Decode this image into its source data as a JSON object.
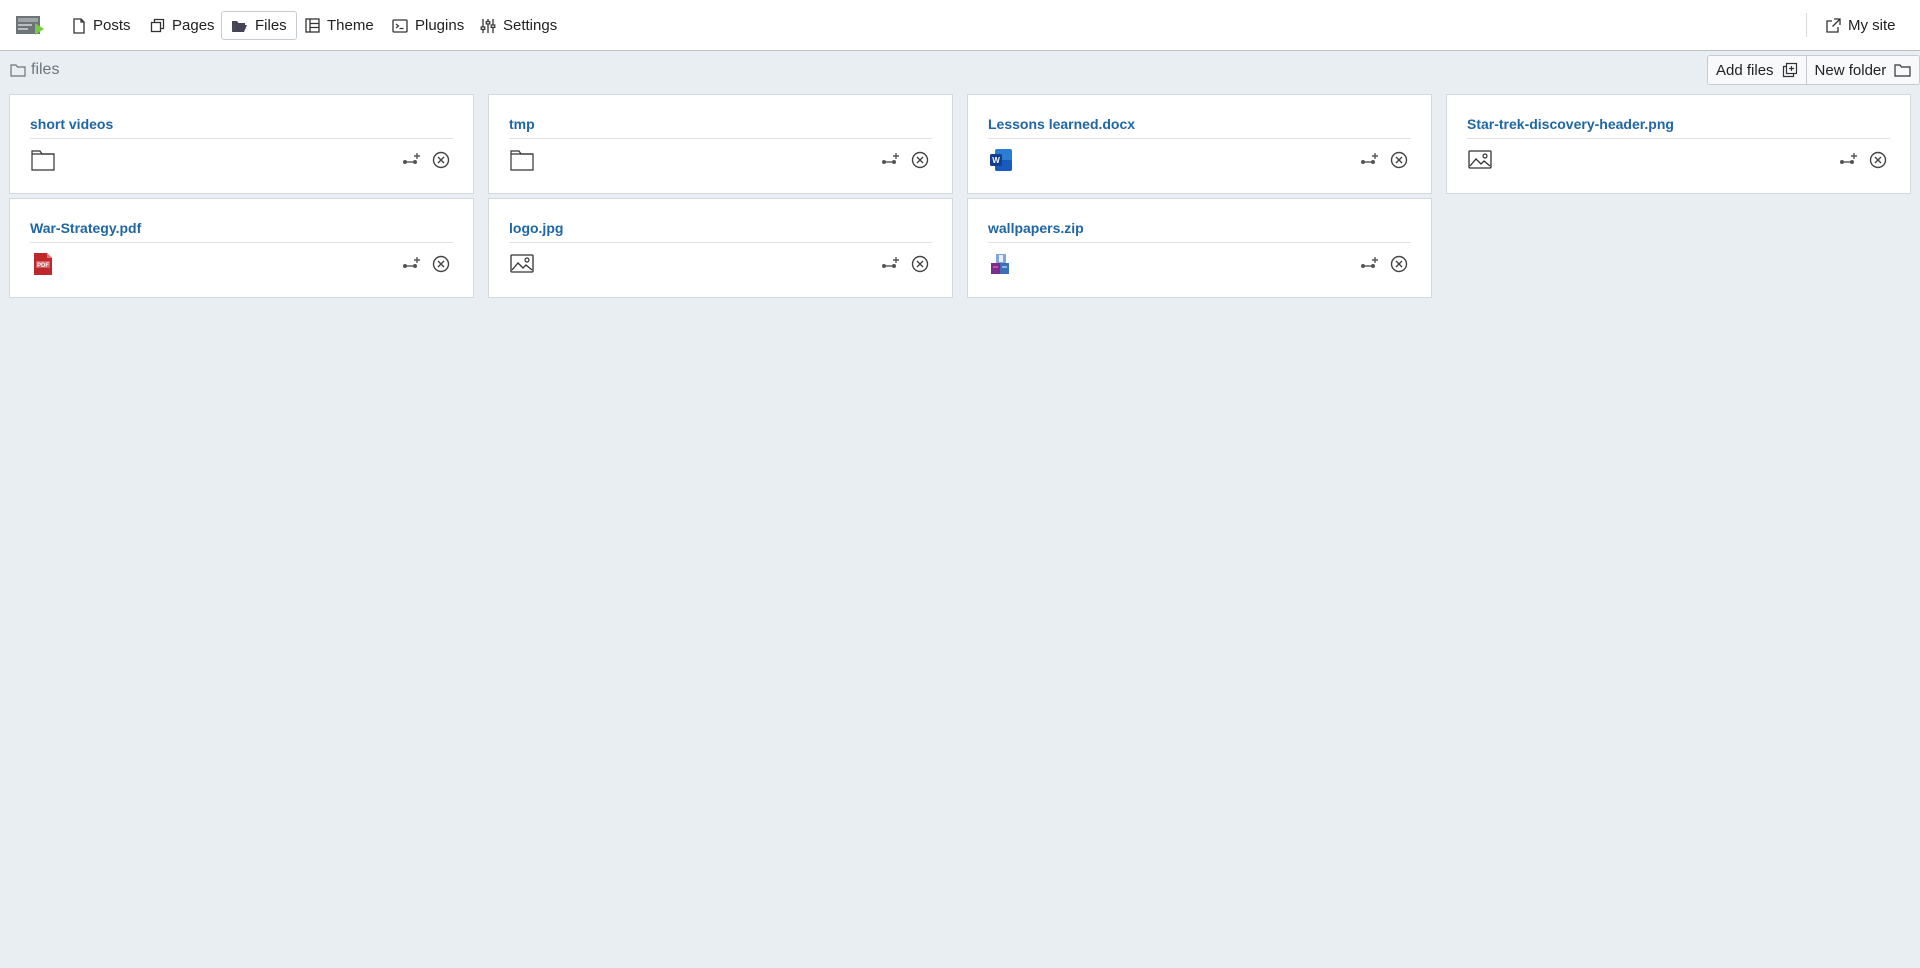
{
  "nav": {
    "items": [
      {
        "label": "Posts",
        "icon": "document-icon"
      },
      {
        "label": "Pages",
        "icon": "pages-icon"
      },
      {
        "label": "Files",
        "icon": "folder-open-icon",
        "active": true
      },
      {
        "label": "Theme",
        "icon": "layout-icon"
      },
      {
        "label": "Plugins",
        "icon": "terminal-icon"
      },
      {
        "label": "Settings",
        "icon": "sliders-icon"
      }
    ],
    "my_site": {
      "label": "My site",
      "icon": "external-link-icon"
    }
  },
  "toolbar": {
    "path": "files",
    "add_files_label": "Add files",
    "new_folder_label": "New folder"
  },
  "files": [
    {
      "name": "short videos",
      "type": "folder",
      "icon": "folder-icon"
    },
    {
      "name": "tmp",
      "type": "folder",
      "icon": "folder-icon"
    },
    {
      "name": "Lessons learned.docx",
      "type": "word",
      "icon": "word-document-icon"
    },
    {
      "name": "Star-trek-discovery-header.png",
      "type": "image",
      "icon": "image-icon"
    },
    {
      "name": "War-Strategy.pdf",
      "type": "pdf",
      "icon": "pdf-icon"
    },
    {
      "name": "logo.jpg",
      "type": "image",
      "icon": "image-icon"
    },
    {
      "name": "wallpapers.zip",
      "type": "archive",
      "icon": "archive-icon"
    }
  ],
  "colors": {
    "accent": "#1f66a5",
    "background": "#e9eef2"
  }
}
